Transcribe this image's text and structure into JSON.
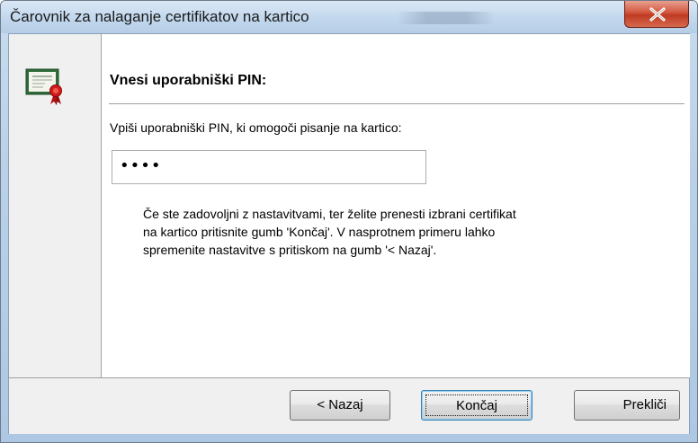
{
  "window": {
    "title": "Čarovnik za nalaganje certifikatov na kartico"
  },
  "page": {
    "heading": "Vnesi uporabniški PIN:",
    "prompt": "Vpiši uporabniški PIN, ki omogoči pisanje na kartico:",
    "pin_value": "••••",
    "info_lines": [
      "Če ste zadovoljni z nastavitvami, ter želite prenesti izbrani certifikat",
      "na kartico pritisnite gumb 'Končaj'. V nasprotnem primeru lahko",
      "spremenite nastavitve s pritiskom na gumb '< Nazaj'."
    ]
  },
  "buttons": {
    "back": "< Nazaj",
    "finish": "Končaj",
    "cancel": "Prekliči"
  },
  "icons": {
    "close": "close-icon",
    "certificate": "certificate-icon"
  },
  "colors": {
    "close_button": "#c94a30",
    "title_bar": "#c4d9ee",
    "dialog_bg": "#f0f0f0"
  }
}
